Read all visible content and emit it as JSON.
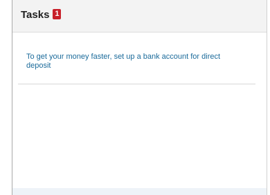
{
  "panel": {
    "title": "Tasks",
    "badge_count": "1",
    "tasks": [
      {
        "label": "To get your money faster, set up a bank account for direct deposit"
      }
    ]
  },
  "colors": {
    "header_bg": "#f3f3f3",
    "badge": "#c8202a",
    "link": "#1a6a9a"
  }
}
